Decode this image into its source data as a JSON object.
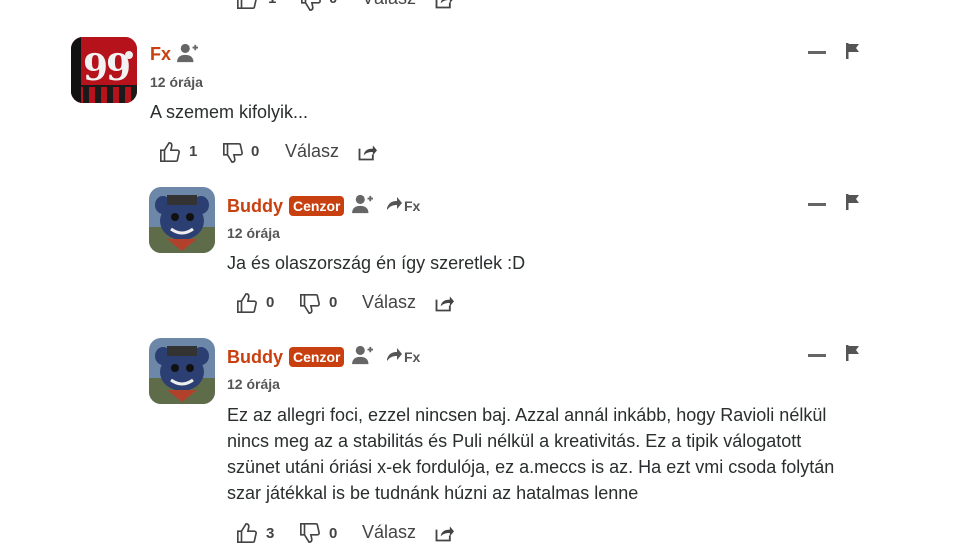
{
  "top_partial": {
    "likes": "1",
    "dislikes": "0",
    "reply_label": "Válasz"
  },
  "comments": [
    {
      "author": "Fx",
      "badge": "",
      "reply_to": "",
      "time": "12 órája",
      "text": "A szemem kifolyik...",
      "likes": "1",
      "dislikes": "0",
      "reply_label": "Válasz",
      "avatar_text": "99"
    },
    {
      "author": "Buddy",
      "badge": "Cenzor",
      "reply_to": "Fx",
      "time": "12 órája",
      "text": "Ja és olaszország én így szeretlek :D",
      "likes": "0",
      "dislikes": "0",
      "reply_label": "Válasz"
    },
    {
      "author": "Buddy",
      "badge": "Cenzor",
      "reply_to": "Fx",
      "time": "12 órája",
      "text_lines": [
        "Ez az allegri foci, ezzel nincsen baj. Azzal annál inkább, hogy Ravioli nélkül",
        "nincs meg az a stabilitás és Puli nélkül a kreativitás. Ez a tipik válogatott",
        "szünet utáni óriási x-ek fordulója, ez a.meccs is az. Ha ezt vmi csoda folytán",
        "szar játékkal is be tudnánk húzni az hatalmas lenne"
      ],
      "likes": "3",
      "dislikes": "0",
      "reply_label": "Válasz"
    }
  ],
  "colors": {
    "author": "#c8400f",
    "badge_bg": "#c8400f",
    "text": "#2a2e2e",
    "muted": "#555555"
  }
}
